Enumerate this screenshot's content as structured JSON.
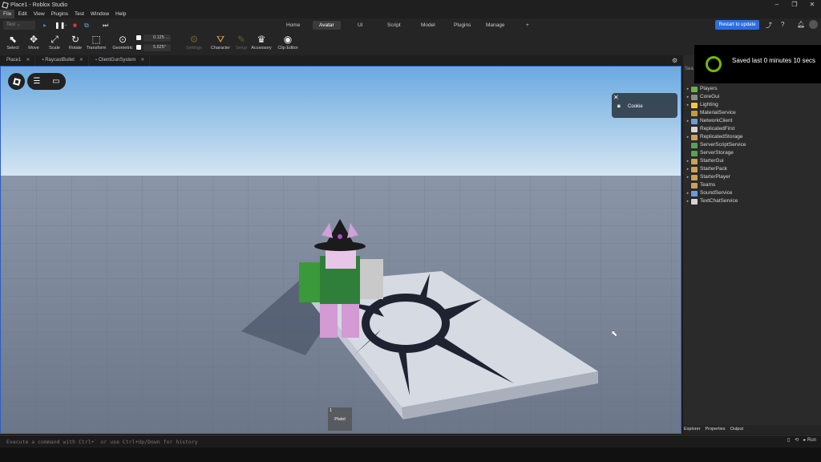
{
  "window": {
    "title": "Place1 - Roblox Studio",
    "buttons": [
      "–",
      "❐",
      "✕"
    ]
  },
  "menu": [
    "File",
    "Edit",
    "View",
    "Plugins",
    "Test",
    "Window",
    "Help"
  ],
  "ribbon": {
    "test_placeholder": "Test",
    "tabs": [
      "Home",
      "Avatar",
      "UI",
      "Script",
      "Model",
      "Plugins",
      "Manage"
    ],
    "add_tab": "+",
    "restart_label": "Restart to update"
  },
  "tools": [
    "Select",
    "Move",
    "Scale",
    "Rotate",
    "Transform",
    "Geometric",
    "Settings",
    "Character",
    "Setup",
    "Accessory",
    "Clip Editor"
  ],
  "increments": {
    "move": "0.125 ...",
    "rotate": "5.625°"
  },
  "doc_tabs": [
    "Place1",
    "RaycastBullet",
    "ClientGunSystem"
  ],
  "viewport": {
    "cookie_label": "Cookie",
    "hotbar": {
      "slot": "1",
      "name": "Pistol"
    }
  },
  "toast": {
    "text": "Saved last 0 minutes 10 secs"
  },
  "explorer": {
    "search_partial": "Sea",
    "items": [
      {
        "name": "Players",
        "color": "#6ab04c",
        "caret": "▸"
      },
      {
        "name": "CoreGui",
        "color": "#8a8a8a",
        "caret": "▸"
      },
      {
        "name": "Lighting",
        "color": "#f5c542",
        "caret": "▸"
      },
      {
        "name": "MaterialService",
        "color": "#c49a3d",
        "caret": ""
      },
      {
        "name": "NetworkClient",
        "color": "#6d9ad8",
        "caret": "▸"
      },
      {
        "name": "ReplicatedFirst",
        "color": "#d4d4d4",
        "caret": ""
      },
      {
        "name": "ReplicatedStorage",
        "color": "#c9a25a",
        "caret": "▸"
      },
      {
        "name": "ServerScriptService",
        "color": "#5aa05a",
        "caret": ""
      },
      {
        "name": "ServerStorage",
        "color": "#5aa05a",
        "caret": ""
      },
      {
        "name": "StarterGui",
        "color": "#c9a25a",
        "caret": "▸"
      },
      {
        "name": "StarterPack",
        "color": "#c9a25a",
        "caret": "▸"
      },
      {
        "name": "StarterPlayer",
        "color": "#c9a25a",
        "caret": "▸"
      },
      {
        "name": "Teams",
        "color": "#c9a25a",
        "caret": ""
      },
      {
        "name": "SoundService",
        "color": "#6d9ad8",
        "caret": "▸"
      },
      {
        "name": "TextChatService",
        "color": "#d4d4d4",
        "caret": "▸"
      }
    ],
    "tabs": [
      "Explorer",
      "Properties",
      "Output"
    ]
  },
  "command_bar": {
    "placeholder": "Execute a command with Ctrl+` or use Ctrl+Up/Down for history",
    "run_label": "Run"
  },
  "colors": {
    "accent": "#2c6de0",
    "sky_top": "#6aa9e0",
    "toast_ring": "#76b900"
  }
}
